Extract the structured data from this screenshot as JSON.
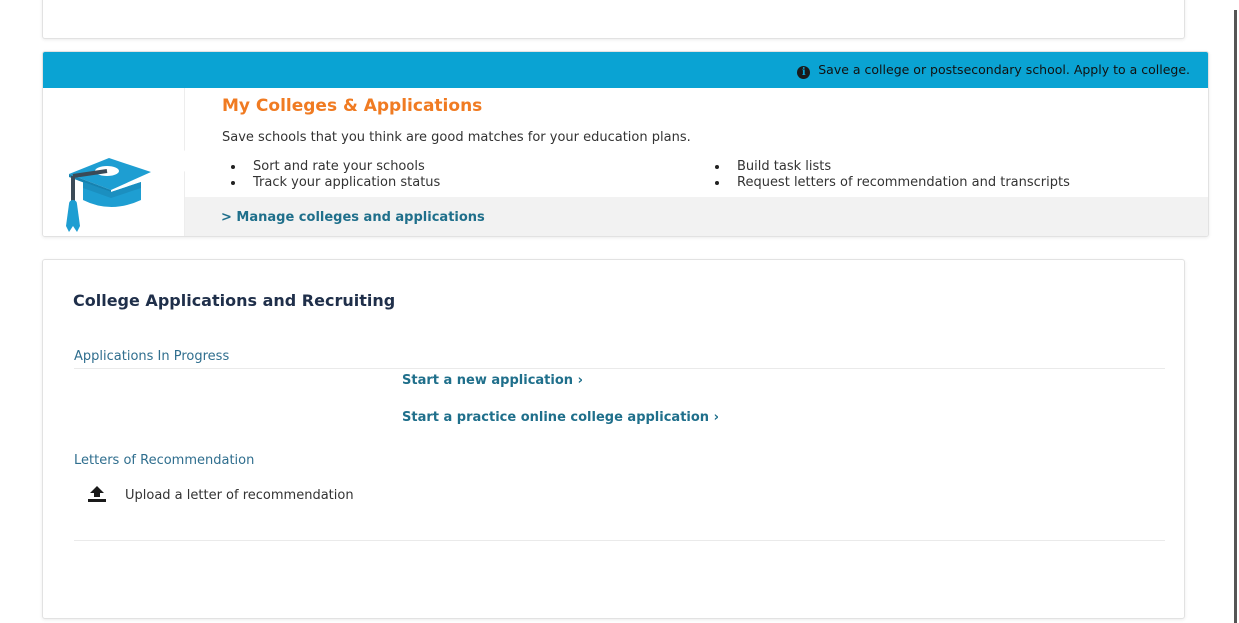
{
  "feature": {
    "banner_text": "Save a college or postsecondary school. Apply to a college.",
    "banner_icon": "info-icon",
    "icon": "graduation-cap-icon",
    "title": "My Colleges & Applications",
    "description": "Save schools that you think are good matches for your education plans.",
    "bullets_left": [
      "Sort and rate your schools",
      "Track your application status"
    ],
    "bullets_right": [
      "Build task lists",
      "Request letters of recommendation and transcripts"
    ],
    "manage_link": "> Manage colleges and applications"
  },
  "applications": {
    "title": "College Applications and Recruiting",
    "in_progress_label": "Applications In Progress",
    "start_new_link": "Start a new application ›",
    "start_practice_link": "Start a practice online college application ›",
    "letters_label": "Letters of Recommendation",
    "upload_icon": "upload-icon",
    "upload_text": "Upload a letter of recommendation"
  },
  "colors": {
    "banner": "#0aa3d3",
    "title_orange": "#f07b22",
    "link_teal": "#1f6f8b",
    "heading_navy": "#1f2f4a"
  }
}
